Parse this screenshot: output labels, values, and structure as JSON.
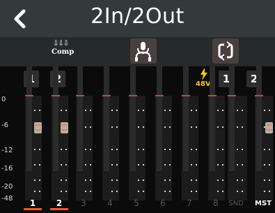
{
  "header": {
    "title": "2In/2Out",
    "back_icon": "chevron-left-icon"
  },
  "toolbar": {
    "comp_label": "Comp",
    "comp_icon": "down-arrows-icon",
    "monitor_icon": "headphone-mic-icon",
    "swap_icon": "swap-arrows-icon"
  },
  "inputs": {
    "ch1": "1",
    "ch2": "2"
  },
  "outputs": {
    "ch1": "1",
    "ch2": "2"
  },
  "phantom": {
    "label": "48V",
    "icon": "lightning-icon",
    "color": "#f5c52a"
  },
  "scale": [
    "0",
    "-6",
    "-12",
    "-16",
    "-20",
    "-48"
  ],
  "channels": [
    {
      "label": "1",
      "active": true
    },
    {
      "label": "2",
      "active": true
    },
    {
      "label": "3",
      "active": false
    },
    {
      "label": "4",
      "active": false
    },
    {
      "label": "5",
      "active": false
    },
    {
      "label": "6",
      "active": false
    },
    {
      "label": "7",
      "active": false
    },
    {
      "label": "8",
      "active": false
    },
    {
      "label": "SND",
      "active": false
    },
    {
      "label": "MST",
      "active": true
    }
  ],
  "colors": {
    "accent": "#f05a2e",
    "peak": "#c0473b",
    "header": "#343a3c"
  }
}
